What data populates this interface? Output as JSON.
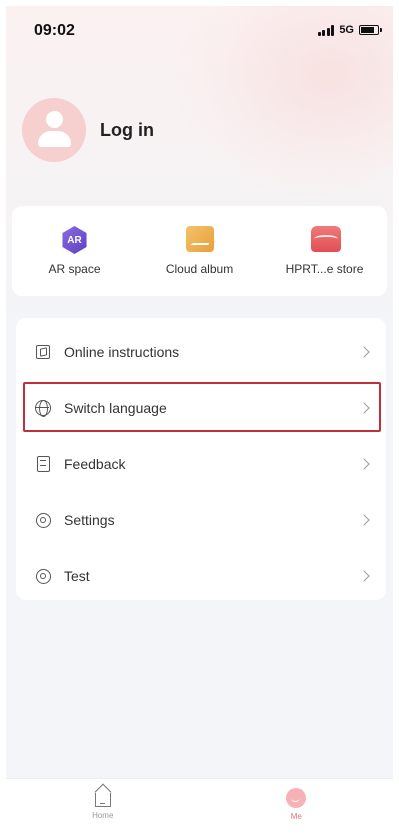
{
  "status_bar": {
    "time": "09:02",
    "network": "5G",
    "signal_icon": "signal-bars-icon",
    "battery_icon": "battery-icon"
  },
  "profile": {
    "avatar_icon": "user-avatar-icon",
    "login_label": "Log in"
  },
  "quick_actions": [
    {
      "label": "AR space",
      "icon": "ar-space-icon",
      "icon_text": "AR",
      "color": "#6a4fd0"
    },
    {
      "label": "Cloud album",
      "icon": "cloud-album-icon",
      "color": "#eeb04f"
    },
    {
      "label": "HPRT...e store",
      "icon": "store-icon",
      "color": "#e85a60"
    }
  ],
  "menu": [
    {
      "label": "Online instructions",
      "icon": "book-icon"
    },
    {
      "label": "Switch language",
      "icon": "globe-icon",
      "highlighted": true
    },
    {
      "label": "Feedback",
      "icon": "document-icon"
    },
    {
      "label": "Settings",
      "icon": "gear-icon"
    },
    {
      "label": "Test",
      "icon": "gear-icon"
    }
  ],
  "bottom_nav": [
    {
      "label": "Home",
      "icon": "home-icon",
      "active": false
    },
    {
      "label": "Me",
      "icon": "me-icon",
      "active": true
    }
  ],
  "colors": {
    "highlight_border": "#c0303a",
    "accent": "#e6737a"
  }
}
